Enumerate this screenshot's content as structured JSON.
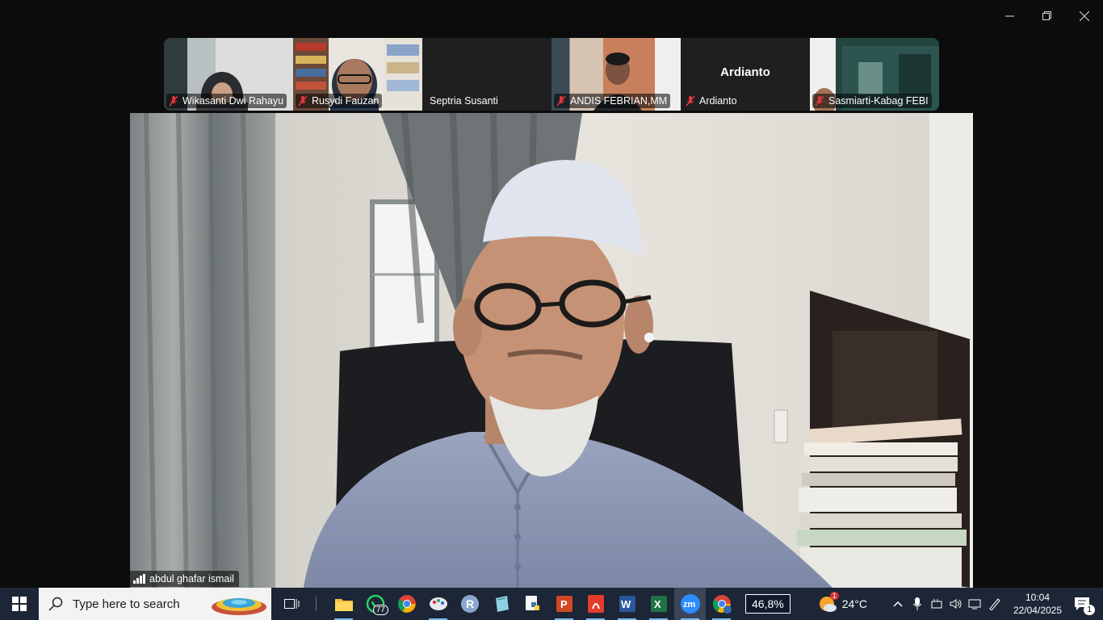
{
  "window": {
    "controls": [
      "minimize",
      "restore",
      "close"
    ]
  },
  "participants": [
    {
      "name": "Wikasanti Dwi Rahayu",
      "muted": true,
      "video": true
    },
    {
      "name": "Rusydi Fauzan",
      "muted": true,
      "video": true
    },
    {
      "name": "Septria Susanti",
      "muted": false,
      "video": false
    },
    {
      "name": "ANDIS FEBRIAN,MM",
      "muted": true,
      "video": true
    },
    {
      "name": "Ardianto",
      "muted": true,
      "video": false,
      "display_name": "Ardianto"
    },
    {
      "name": "Sasmiarti-Kabag FEBI",
      "muted": true,
      "video": true
    }
  ],
  "speaker": {
    "name": "abdul ghafar ismail"
  },
  "taskbar": {
    "search_placeholder": "Type here to search",
    "whatsapp_badge": "77",
    "battery": "46,8%",
    "temperature": "24°C",
    "weather_badge": "1",
    "time": "10:04",
    "date": "22/04/2025",
    "notification_count": "1",
    "apps": [
      "task-view",
      "file-explorer",
      "whatsapp",
      "chrome",
      "paint",
      "r",
      "notepad",
      "python",
      "powerpoint",
      "pdf-reader",
      "word",
      "excel",
      "zoom",
      "chrome-profile"
    ]
  },
  "colors": {
    "taskbar": "#1c2636",
    "muted_mic": "#e0353b",
    "window_bg": "#0c0c0c"
  }
}
